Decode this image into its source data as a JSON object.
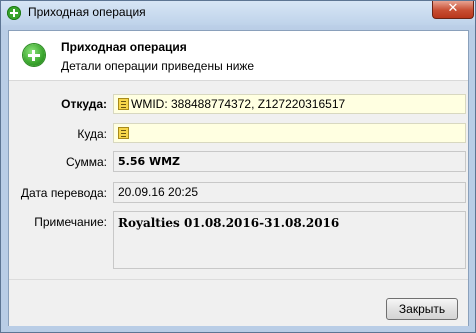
{
  "window": {
    "title": "Приходная операция",
    "close_glyph": "✕"
  },
  "header": {
    "title": "Приходная операция",
    "subtitle": "Детали операции приведены ниже"
  },
  "form": {
    "from_label": "Откуда:",
    "from_value": "WMID: 388488774372, Z127220316517",
    "to_label": "Куда:",
    "to_value": "",
    "amount_label": "Сумма:",
    "amount_value": "5.56 WMZ",
    "date_label": "Дата перевода:",
    "date_value": "20.09.16 20:25",
    "note_label": "Примечание:",
    "note_value": "Royalties 01.08.2016-31.08.2016"
  },
  "footer": {
    "close_label": "Закрыть"
  },
  "colors": {
    "accent_green": "#3aa52d",
    "field_yellow": "#ffffe1",
    "close_red": "#c74d32"
  },
  "icons": {
    "window_icon": "plus-circle-icon",
    "header_icon": "plus-circle-icon",
    "wallet_icon": "wm-passport-icon"
  }
}
